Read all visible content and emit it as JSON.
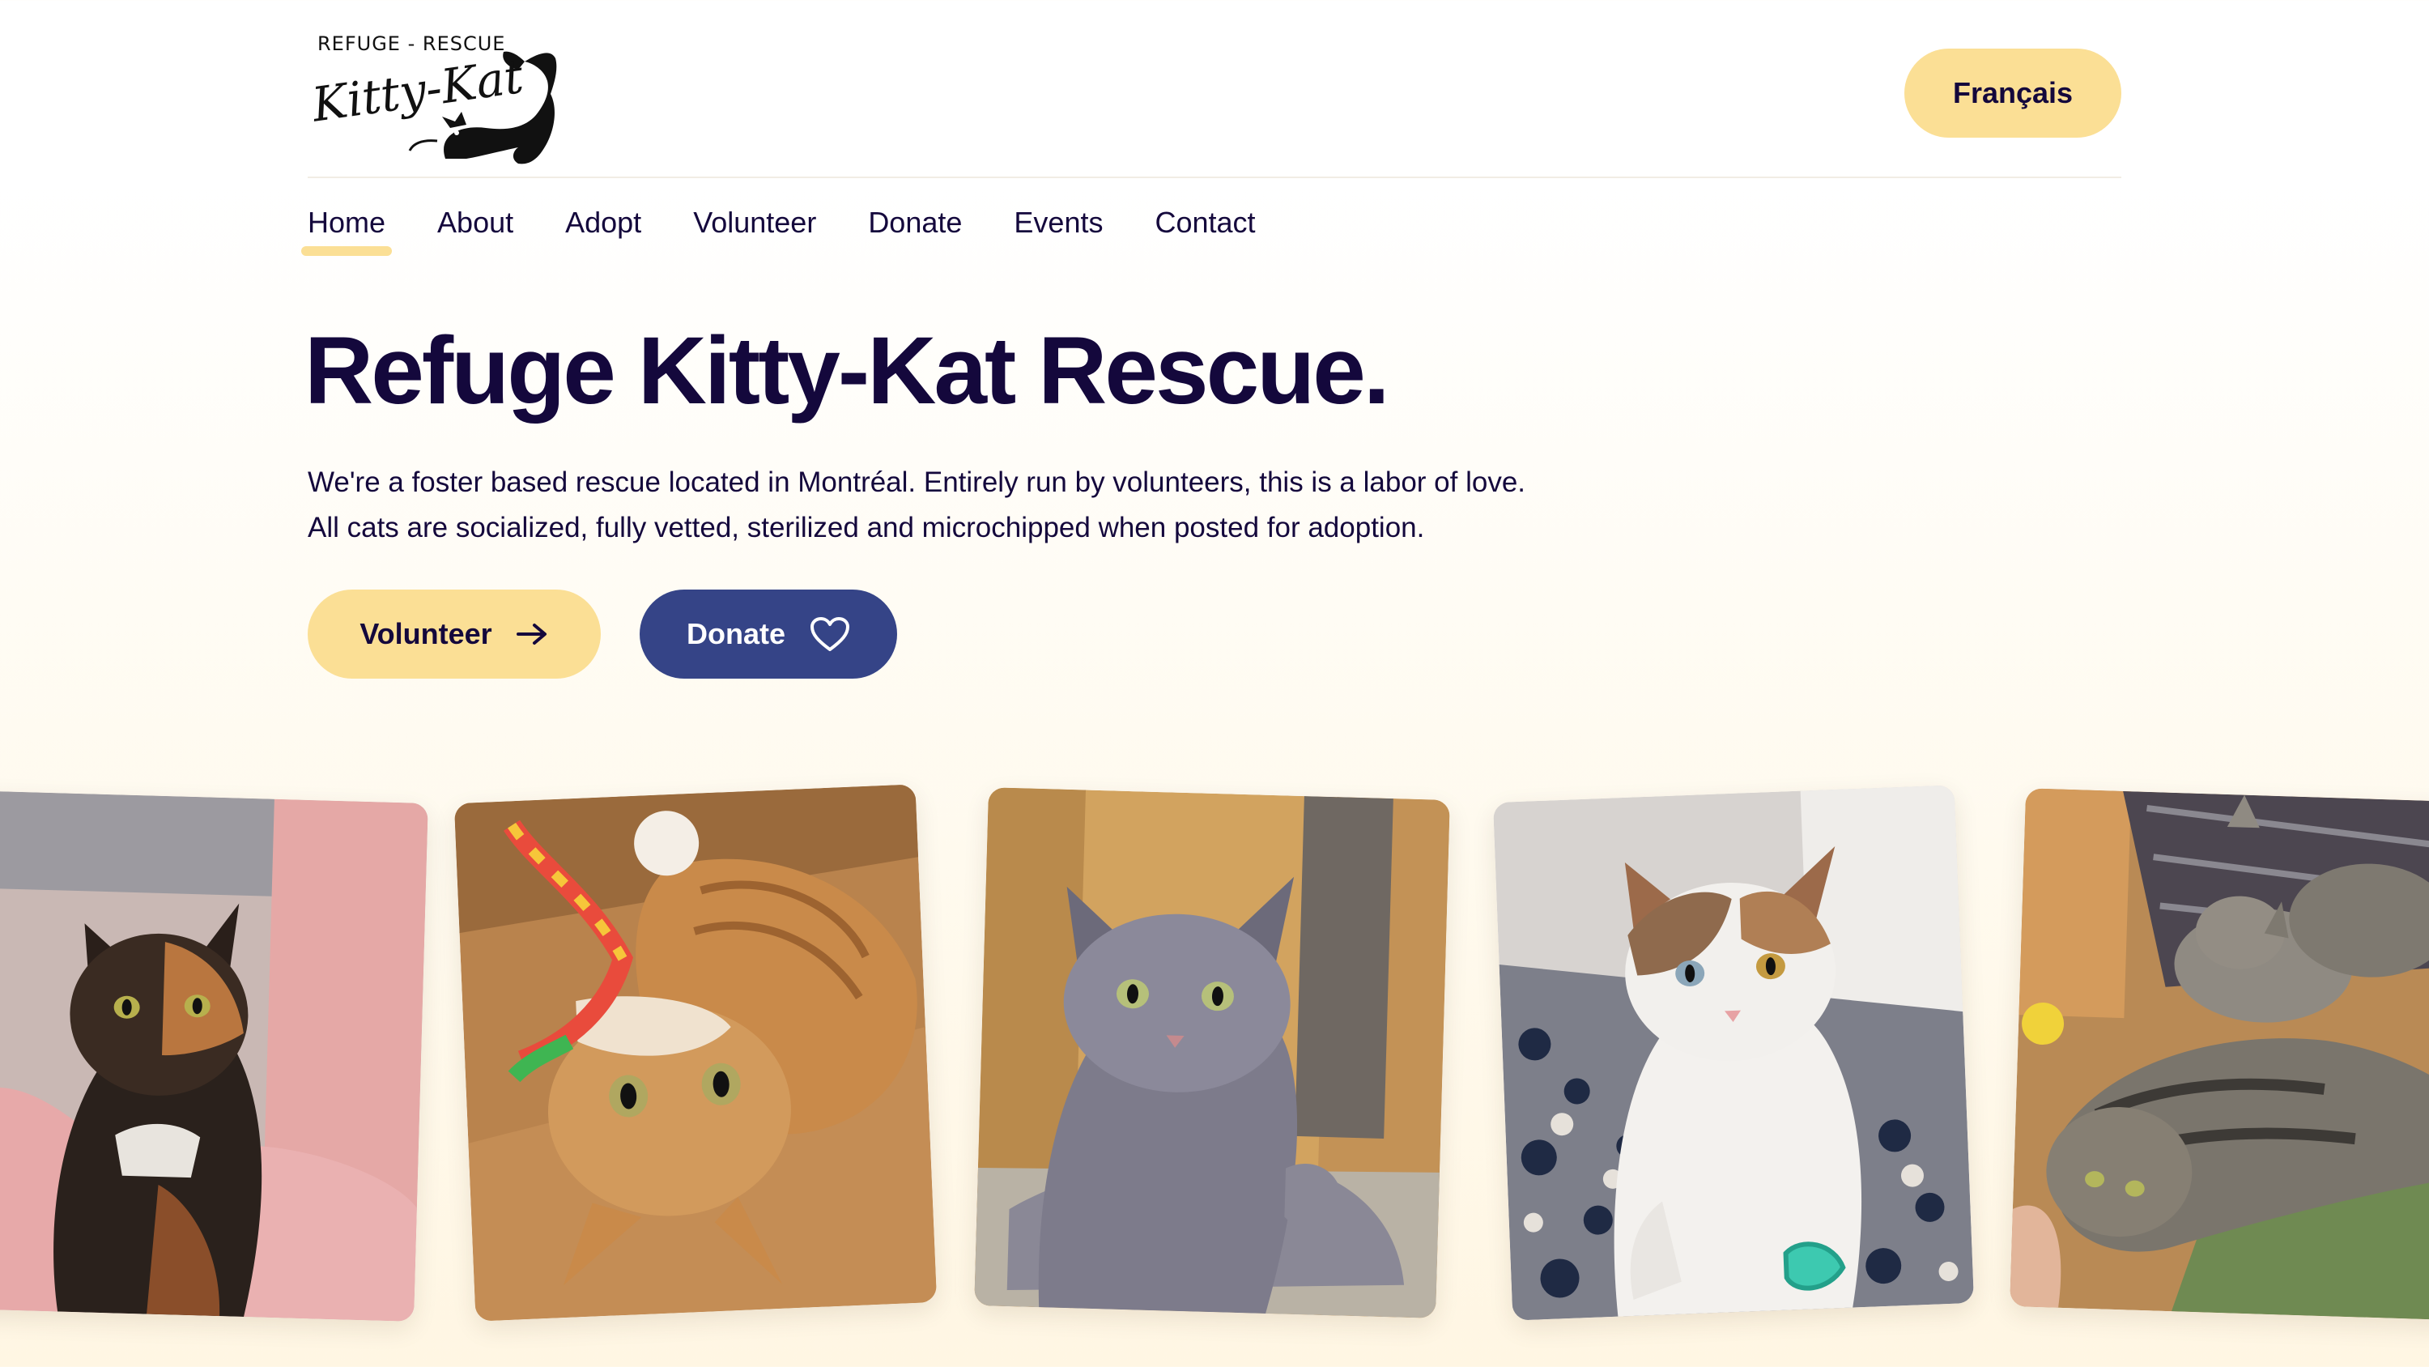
{
  "header": {
    "logo": {
      "top_text": "REFUGE - RESCUE",
      "script_text": "Kitty-Kat"
    },
    "language_button": "Français"
  },
  "nav": {
    "items": [
      {
        "label": "Home",
        "active": true
      },
      {
        "label": "About",
        "active": false
      },
      {
        "label": "Adopt",
        "active": false
      },
      {
        "label": "Volunteer",
        "active": false
      },
      {
        "label": "Donate",
        "active": false
      },
      {
        "label": "Events",
        "active": false
      },
      {
        "label": "Contact",
        "active": false
      }
    ]
  },
  "hero": {
    "title": "Refuge Kitty-Kat Rescue.",
    "description_lines": [
      "We're a foster based rescue located in Montréal. Entirely run by volunteers, this is a labor of love.",
      "All cats are socialized, fully vetted, sterilized and microchipped when posted for adoption."
    ],
    "buttons": {
      "volunteer": {
        "label": "Volunteer",
        "icon": "arrow-right-icon"
      },
      "donate": {
        "label": "Donate",
        "icon": "heart-outline-icon"
      }
    }
  },
  "gallery": {
    "photos": [
      {
        "subject": "tortoiseshell cat on pink blanket",
        "icon": "cat-photo"
      },
      {
        "subject": "orange tabby lying upside down with rainbow toy",
        "icon": "cat-photo"
      },
      {
        "subject": "gray fluffy cat on scratching post",
        "icon": "cat-photo"
      },
      {
        "subject": "white and calico cat on rug with spring toy",
        "icon": "cat-photo"
      },
      {
        "subject": "tabby cat with kittens",
        "icon": "cat-photo"
      }
    ]
  },
  "colors": {
    "navy_text": "#14083c",
    "accent_yellow": "#fbdf95",
    "donate_blue": "#354487",
    "page_background": "#fffbf1"
  }
}
